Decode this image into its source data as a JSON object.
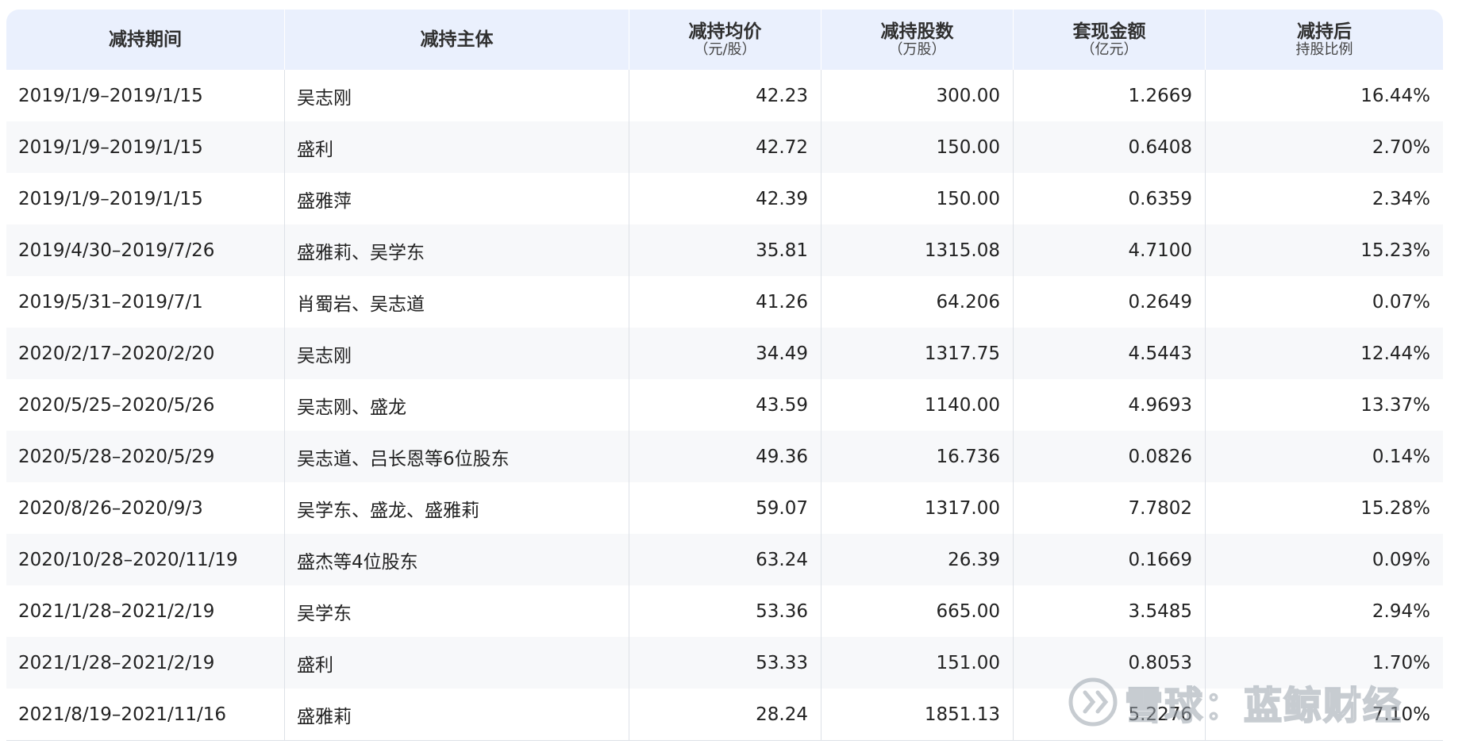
{
  "table": {
    "headers": [
      {
        "main": "减持期间",
        "sub": ""
      },
      {
        "main": "减持主体",
        "sub": ""
      },
      {
        "main": "减持均价",
        "sub": "（元/股）"
      },
      {
        "main": "减持股数",
        "sub": "（万股）"
      },
      {
        "main": "套现金额",
        "sub": "（亿元）"
      },
      {
        "main": "减持后",
        "sub": "持股比例"
      }
    ],
    "rows": [
      [
        "2019/1/9–2019/1/15",
        "吴志刚",
        "42.23",
        "300.00",
        "1.2669",
        "16.44%"
      ],
      [
        "2019/1/9–2019/1/15",
        "盛利",
        "42.72",
        "150.00",
        "0.6408",
        "2.70%"
      ],
      [
        "2019/1/9–2019/1/15",
        "盛雅萍",
        "42.39",
        "150.00",
        "0.6359",
        "2.34%"
      ],
      [
        "2019/4/30–2019/7/26",
        "盛雅莉、吴学东",
        "35.81",
        "1315.08",
        "4.7100",
        "15.23%"
      ],
      [
        "2019/5/31–2019/7/1",
        "肖蜀岩、吴志道",
        "41.26",
        "64.206",
        "0.2649",
        "0.07%"
      ],
      [
        "2020/2/17–2020/2/20",
        "吴志刚",
        "34.49",
        "1317.75",
        "4.5443",
        "12.44%"
      ],
      [
        "2020/5/25–2020/5/26",
        "吴志刚、盛龙",
        "43.59",
        "1140.00",
        "4.9693",
        "13.37%"
      ],
      [
        "2020/5/28–2020/5/29",
        "吴志道、吕长恩等6位股东",
        "49.36",
        "16.736",
        "0.0826",
        "0.14%"
      ],
      [
        "2020/8/26–2020/9/3",
        "吴学东、盛龙、盛雅莉",
        "59.07",
        "1317.00",
        "7.7802",
        "15.28%"
      ],
      [
        "2020/10/28–2020/11/19",
        "盛杰等4位股东",
        "63.24",
        "26.39",
        "0.1669",
        "0.09%"
      ],
      [
        "2021/1/28–2021/2/19",
        "吴学东",
        "53.36",
        "665.00",
        "3.5485",
        "2.94%"
      ],
      [
        "2021/1/28–2021/2/19",
        "盛利",
        "53.33",
        "151.00",
        "0.8053",
        "1.70%"
      ],
      [
        "2021/8/19–2021/11/16",
        "盛雅莉",
        "28.24",
        "1851.13",
        "5.2276",
        "7.10%"
      ]
    ]
  },
  "watermark": {
    "text": "雪球：蓝鲸财经",
    "icon": "snowball-logo-icon"
  },
  "colors": {
    "header_bg": "#eaf0fd",
    "stripe_bg": "#f7f8fa",
    "border": "#dde1e7"
  }
}
